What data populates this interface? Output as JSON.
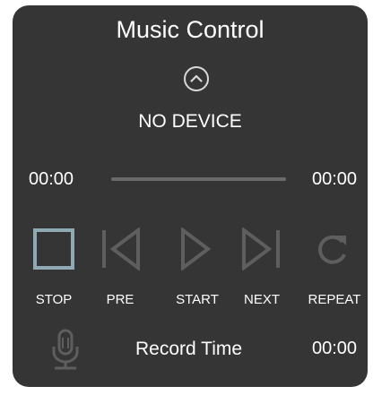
{
  "panel": {
    "title": "Music Control",
    "device_status": "NO DEVICE"
  },
  "playback": {
    "elapsed": "00:00",
    "total": "00:00",
    "progress_fraction": 0
  },
  "controls": [
    {
      "label": "STOP",
      "icon": "stop-icon",
      "active": true
    },
    {
      "label": "PRE",
      "icon": "previous-icon",
      "active": false
    },
    {
      "label": "START",
      "icon": "play-icon",
      "active": false
    },
    {
      "label": "NEXT",
      "icon": "next-icon",
      "active": false
    },
    {
      "label": "REPEAT",
      "icon": "repeat-icon",
      "active": false
    }
  ],
  "record": {
    "icon": "microphone-icon",
    "label": "Record Time",
    "time": "00:00"
  },
  "colors": {
    "panel_background": "#353535",
    "text": "#ffffff",
    "icon_inactive": "#5e5e5e",
    "icon_active": "#8fa9b5"
  }
}
